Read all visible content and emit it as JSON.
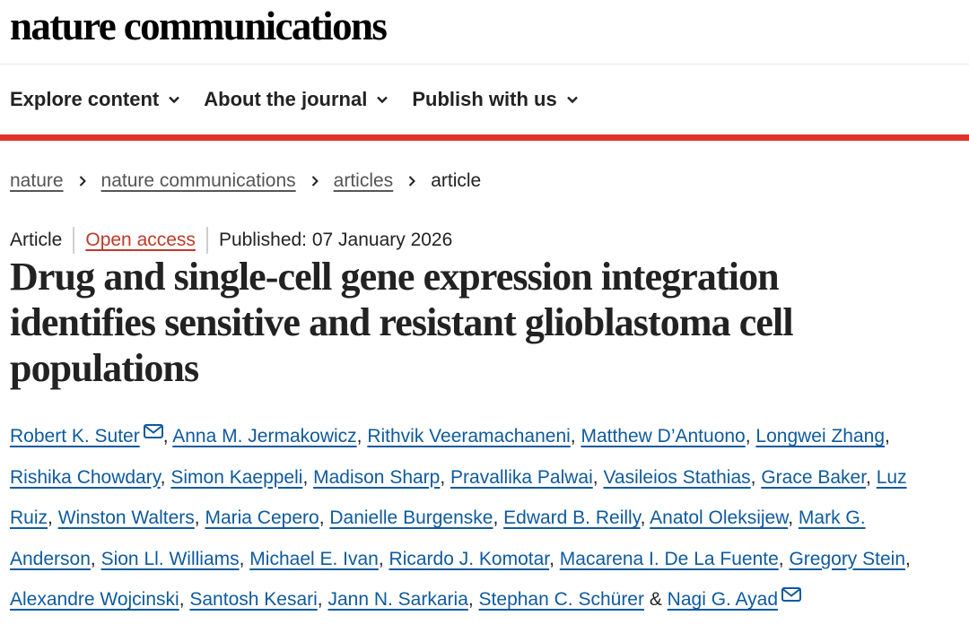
{
  "masthead": {
    "brand": "nature communications"
  },
  "nav": {
    "items": [
      {
        "label": "Explore content"
      },
      {
        "label": "About the journal"
      },
      {
        "label": "Publish with us"
      }
    ]
  },
  "breadcrumb": {
    "items": [
      "nature",
      "nature communications",
      "articles"
    ],
    "current": "article"
  },
  "article": {
    "type": "Article",
    "access": "Open access",
    "published": "Published: 07 January 2026",
    "title": "Drug and single-cell gene expression integration identifies sensitive and resistant glioblastoma cell populations",
    "authors": [
      "Robert K. Suter",
      "Anna M. Jermakowicz",
      "Rithvik Veeramachaneni",
      "Matthew D’Antuono",
      "Longwei Zhang",
      "Rishika Chowdary",
      "Simon Kaeppeli",
      "Madison Sharp",
      "Pravallika Palwai",
      "Vasileios Stathias",
      "Grace Baker",
      "Luz Ruiz",
      "Winston Walters",
      "Maria Cepero",
      "Danielle Burgenske",
      "Edward B. Reilly",
      "Anatol Oleksijew",
      "Mark G. Anderson",
      "Sion Ll. Williams",
      "Michael E. Ivan",
      "Ricardo J. Komotar",
      "Macarena I. De La Fuente",
      "Gregory Stein",
      "Alexandre Wojcinski",
      "Santosh Kesari",
      "Jann N. Sarkaria",
      "Stephan C. Schürer",
      "Nagi G. Ayad"
    ],
    "final_separator": "&",
    "icons": {
      "chevron": "chevron-down-icon",
      "breadcrumb": "chevron-right-icon",
      "mail": "mail-icon"
    }
  },
  "colors": {
    "accent": "#e0332c",
    "link": "#0f5a9e",
    "open_access": "#c0392b"
  }
}
